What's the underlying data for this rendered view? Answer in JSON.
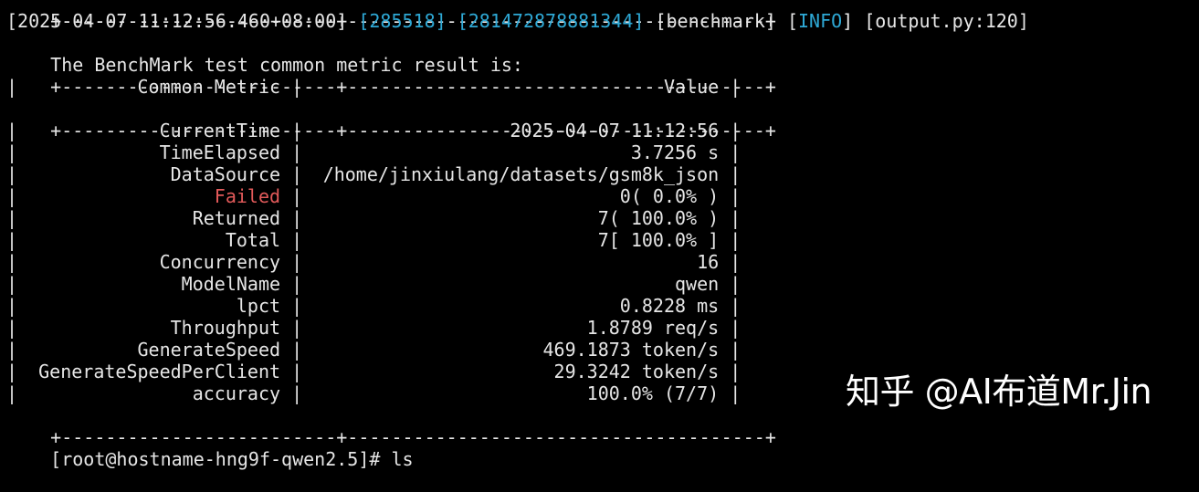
{
  "log": {
    "timestamp": "[2025-04-07 11:12:56.460+08:00]",
    "pid": "[285518]",
    "tid": "[281472878881344]",
    "module": "[benchmark]",
    "level_open": "[",
    "level": "INFO",
    "level_close": "]",
    "source": "[output.py:120]",
    "message": "The BenchMark test common metric result is:"
  },
  "table": {
    "border": "+-------------------------+--------------------------------------+",
    "header_metric": "Common Metric",
    "header_value": "Value",
    "rows": [
      {
        "metric": "CurrentTime",
        "value": "2025-04-07 11:12:56",
        "status": "normal"
      },
      {
        "metric": "TimeElapsed",
        "value": "3.7256 s",
        "status": "normal"
      },
      {
        "metric": "DataSource",
        "value": "/home/jinxiulang/datasets/gsm8k_json",
        "status": "normal"
      },
      {
        "metric": "Failed",
        "value": "0( 0.0% )",
        "status": "error"
      },
      {
        "metric": "Returned",
        "value": "7( 100.0% )",
        "status": "normal"
      },
      {
        "metric": "Total",
        "value": "7[ 100.0% ]",
        "status": "normal"
      },
      {
        "metric": "Concurrency",
        "value": "16",
        "status": "normal"
      },
      {
        "metric": "ModelName",
        "value": "qwen",
        "status": "normal"
      },
      {
        "metric": "lpct",
        "value": "0.8228 ms",
        "status": "normal"
      },
      {
        "metric": "Throughput",
        "value": "1.8789 req/s",
        "status": "normal"
      },
      {
        "metric": "GenerateSpeed",
        "value": "469.1873 token/s",
        "status": "normal"
      },
      {
        "metric": "GenerateSpeedPerClient",
        "value": "29.3242 token/s",
        "status": "normal"
      },
      {
        "metric": "accuracy",
        "value": "100.0% (7/7)",
        "status": "normal"
      }
    ]
  },
  "prompt": "[root@hostname-hng9f-qwen2.5]# ls",
  "watermark": "知乎 @AI布道Mr.Jin",
  "colors": {
    "background": "#000000",
    "text": "#e6e6e6",
    "accent": "#2ea9d6",
    "error": "#e25a5a"
  }
}
